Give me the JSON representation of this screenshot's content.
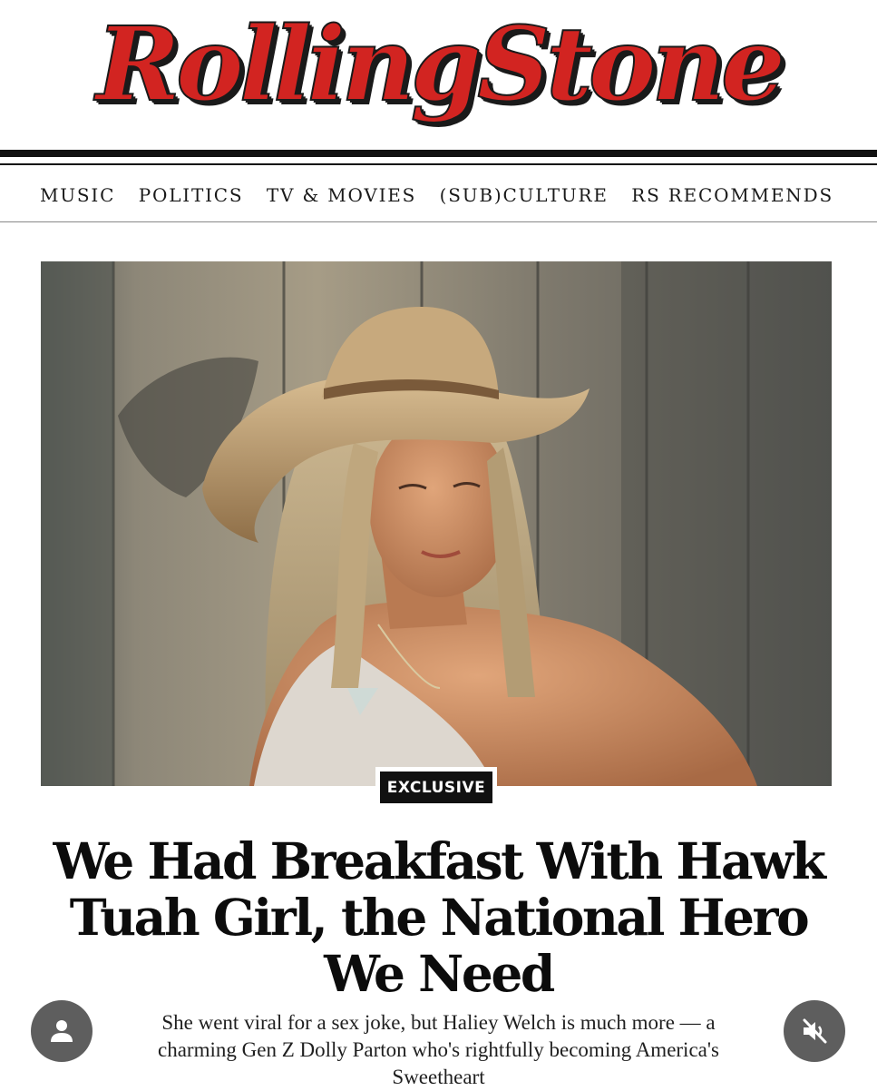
{
  "masthead": {
    "logo_text": "RollingStone"
  },
  "nav": {
    "items": [
      {
        "label": "MUSIC"
      },
      {
        "label": "POLITICS"
      },
      {
        "label": "TV & MOVIES"
      },
      {
        "label": "(SUB)CULTURE"
      },
      {
        "label": "RS RECOMMENDS"
      }
    ]
  },
  "article": {
    "badge": "EXCLUSIVE",
    "headline": "We Had Breakfast With Hawk Tuah Girl, the National Hero We Need",
    "dek": "She went viral for a sex joke, but Haliey Welch is much more — a charming Gen Z Dolly Parton who's rightfully becoming America's Sweetheart"
  },
  "overlay": {
    "profile_icon": "user-icon",
    "mute_icon": "speaker-muted-icon"
  },
  "colors": {
    "logo_red": "#d22421",
    "ink": "#111111",
    "overlay_button": "#5e5e5e"
  }
}
